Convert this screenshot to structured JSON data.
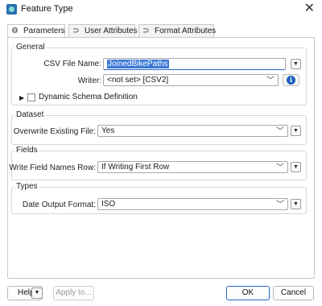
{
  "window": {
    "title": "Feature Type",
    "close_glyph": "✕"
  },
  "tabs": [
    {
      "label": "Parameters",
      "icon": "gear-icon",
      "glyph": "⚙"
    },
    {
      "label": "User Attributes",
      "icon": "attribute-icon",
      "glyph": "⊃"
    },
    {
      "label": "Format Attributes",
      "icon": "attribute-icon",
      "glyph": "⊃"
    }
  ],
  "general": {
    "heading": "General",
    "csv_label": "CSV File Name:",
    "csv_value": "JoinedBikePaths",
    "writer_label": "Writer:",
    "writer_value": "<not set> [CSV2]",
    "dynamic_label": "Dynamic Schema Definition",
    "dynamic_checked": false
  },
  "dataset": {
    "heading": "Dataset",
    "label": "Overwrite Existing File:",
    "value": "Yes"
  },
  "fields": {
    "heading": "Fields",
    "label": "Write Field Names Row:",
    "value": "If Writing First Row"
  },
  "types": {
    "heading": "Types",
    "label": "Date Output Format:",
    "value": "ISO"
  },
  "footer": {
    "help": "Help",
    "apply": "Apply to...",
    "ok": "OK",
    "cancel": "Cancel"
  },
  "glyphs": {
    "combo_arrow": "﹀",
    "menu_arrow": "▼",
    "expand_arrow": "▶",
    "info": "i"
  },
  "colors": {
    "accent": "#2a62c9",
    "selection": "#3b79d9",
    "info": "#1f5fbf"
  }
}
